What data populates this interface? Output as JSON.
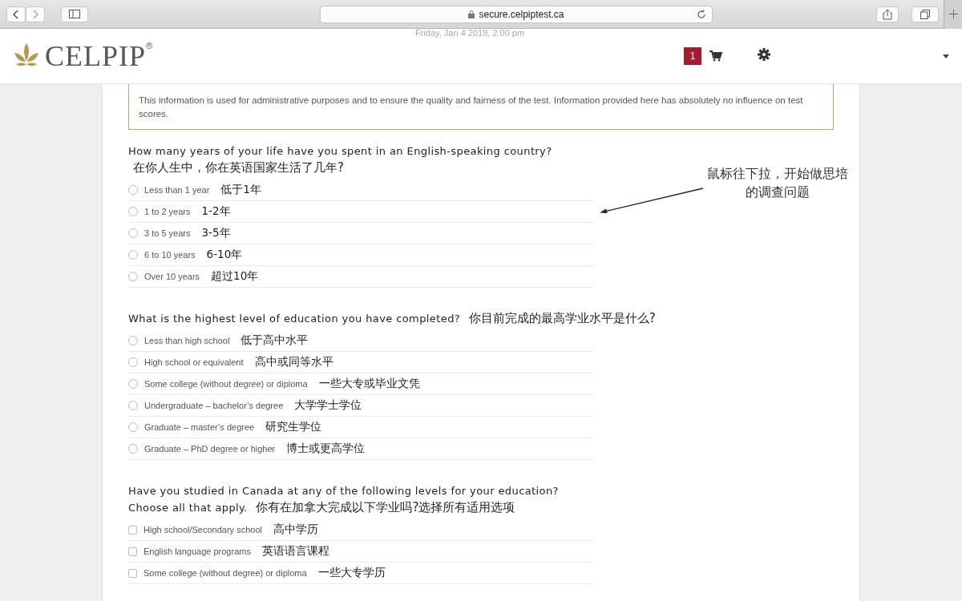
{
  "browser": {
    "url": "secure.celpiptest.ca"
  },
  "header": {
    "logo": "CELPIP",
    "registered": "®",
    "date": "Friday, Jan 4 2019, 2:00 pm",
    "cart_count": "1"
  },
  "notice": "This information is used for administrative purposes and to ensure the quality and fairness of the test. Information provided here has absolutely no influence on test scores.",
  "questions": [
    {
      "title": "How many years of your life have you spent in an English-speaking country?",
      "note": "在你人生中，你在英语国家生活了几年?",
      "kind": "radio",
      "options": [
        {
          "label": "Less than 1 year",
          "note": "低于1年",
          "selected": false
        },
        {
          "label": "1 to 2 years",
          "note": "1-2年",
          "selected": false
        },
        {
          "label": "3 to 5 years",
          "note": "3-5年",
          "selected": false
        },
        {
          "label": "6 to 10 years",
          "note": "6-10年",
          "selected": false
        },
        {
          "label": "Over 10 years",
          "note": "超过10年",
          "selected": false
        }
      ]
    },
    {
      "title": "What is the highest level of education you have completed?",
      "note": "你目前完成的最高学业水平是什么?",
      "kind": "radio",
      "options": [
        {
          "label": "Less than high school",
          "note": "低于高中水平",
          "selected": false
        },
        {
          "label": "High school or equivalent",
          "note": "高中或同等水平",
          "selected": false
        },
        {
          "label": "Some college (without degree) or diploma",
          "note": "一些大专或毕业文凭",
          "selected": false
        },
        {
          "label": "Undergraduate – bachelor’s degree",
          "note": "大学学士学位",
          "selected": false
        },
        {
          "label": "Graduate – master’s degree",
          "note": "研究生学位",
          "selected": false
        },
        {
          "label": "Graduate – PhD degree or higher",
          "note": "博士或更高学位",
          "selected": false
        }
      ]
    },
    {
      "title": "Have you studied in Canada at any of the following levels for your education? Choose all that apply.",
      "note": "你有在加拿大完成以下学业吗?选择所有适用选项",
      "kind": "checkbox",
      "options": [
        {
          "label": "High school/Secondary school",
          "note": "高中学历",
          "checked": false
        },
        {
          "label": "English language programs",
          "note": "英语语言课程",
          "checked": false
        },
        {
          "label": "Some college (without degree) or diploma",
          "note": "一些大专学历",
          "checked": false
        }
      ]
    }
  ],
  "callout": "鼠标往下拉，开始做思培的调查问题"
}
